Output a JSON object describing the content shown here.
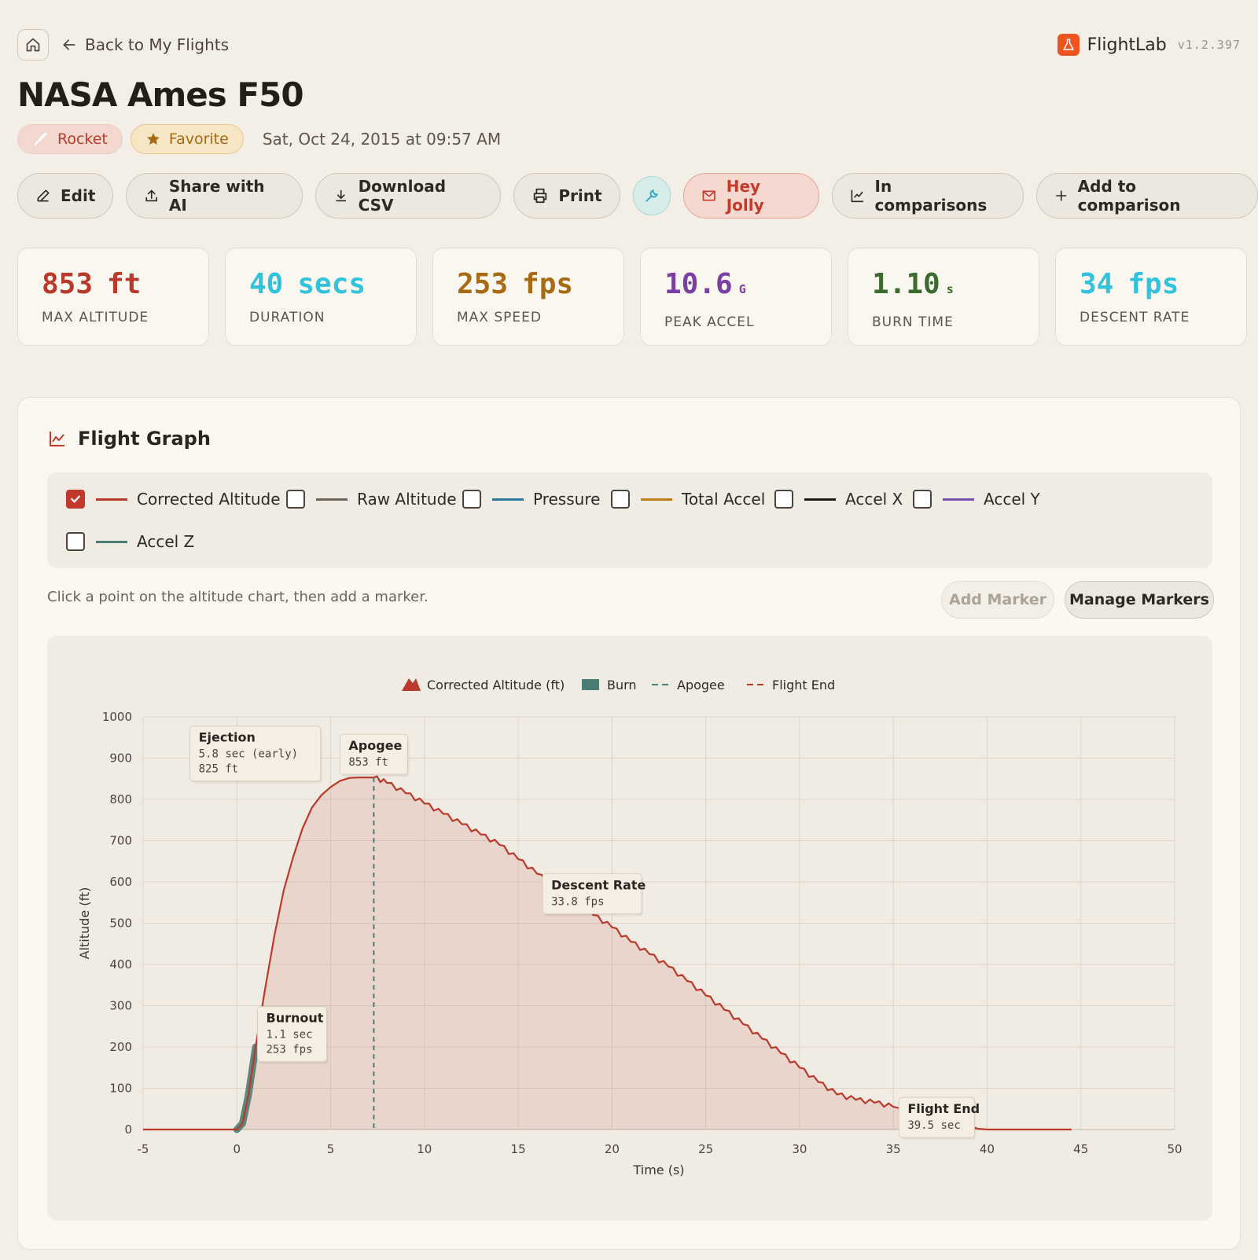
{
  "nav": {
    "back_label": "Back to My Flights"
  },
  "brand": {
    "name": "FlightLab",
    "version": "v1.2.397"
  },
  "flight": {
    "title": "NASA Ames F50",
    "type_badge": "Rocket",
    "favorite_badge": "Favorite",
    "date": "Sat, Oct 24, 2015 at 09:57 AM"
  },
  "actions": {
    "edit": "Edit",
    "share": "Share with AI",
    "download": "Download CSV",
    "print": "Print",
    "jolly": "Hey Jolly",
    "in_comparisons": "In comparisons",
    "add_comparison": "Add to comparison"
  },
  "stats": [
    {
      "value": "853",
      "unit": "ft",
      "label": "MAX ALTITUDE",
      "color": "#b93a2a",
      "unit_style": "big"
    },
    {
      "value": "40",
      "unit": "secs",
      "label": "DURATION",
      "color": "#31c2dc",
      "unit_style": "big"
    },
    {
      "value": "253",
      "unit": "fps",
      "label": "MAX SPEED",
      "color": "#a86a12",
      "unit_style": "big"
    },
    {
      "value": "10.6",
      "unit": "G",
      "label": "PEAK ACCEL",
      "color": "#7a3fa0",
      "unit_style": "small"
    },
    {
      "value": "1.10",
      "unit": "s",
      "label": "BURN TIME",
      "color": "#3c6b2e",
      "unit_style": "small"
    },
    {
      "value": "34",
      "unit": "fps",
      "label": "DESCENT RATE",
      "color": "#31c2dc",
      "unit_style": "big"
    }
  ],
  "graph": {
    "title": "Flight Graph",
    "hint": "Click a point on the altitude chart, then add a marker.",
    "add_marker": "Add Marker",
    "manage_markers": "Manage Markers",
    "series_toggles": [
      {
        "label": "Corrected Altitude",
        "checked": true,
        "color": "#b93a2a"
      },
      {
        "label": "Raw Altitude",
        "checked": false,
        "color": "#6b655b"
      },
      {
        "label": "Pressure",
        "checked": false,
        "color": "#2b7a9e"
      },
      {
        "label": "Total Accel",
        "checked": false,
        "color": "#c07a16"
      },
      {
        "label": "Accel X",
        "checked": false,
        "color": "#1c1a17"
      },
      {
        "label": "Accel Y",
        "checked": false,
        "color": "#7a4fb0"
      },
      {
        "label": "Accel Z",
        "checked": false,
        "color": "#4a7d74"
      }
    ]
  },
  "chart_data": {
    "type": "area",
    "xlabel": "Time (s)",
    "ylabel": "Altitude (ft)",
    "xlim": [
      -5,
      50
    ],
    "ylim": [
      0,
      1000
    ],
    "xticks": [
      -5,
      0,
      5,
      10,
      15,
      20,
      25,
      30,
      35,
      40,
      45,
      50
    ],
    "yticks": [
      0,
      100,
      200,
      300,
      400,
      500,
      600,
      700,
      800,
      900,
      1000
    ],
    "grid": true,
    "legend_position": "top-center",
    "legend": [
      {
        "label": "Corrected Altitude (ft)",
        "kind": "area",
        "color": "#b93a2a"
      },
      {
        "label": "Burn",
        "kind": "block",
        "color": "#4a7d74"
      },
      {
        "label": "Apogee",
        "kind": "dashed",
        "color": "#4a7d74"
      },
      {
        "label": "Flight End",
        "kind": "dashed",
        "color": "#b93a2a"
      }
    ],
    "series": [
      {
        "name": "Corrected Altitude (ft)",
        "x": [
          -5,
          -3,
          -1,
          0,
          0.3,
          0.6,
          1.0,
          1.5,
          2,
          2.5,
          3,
          3.5,
          4,
          4.5,
          5,
          5.5,
          6,
          6.5,
          7,
          7.3,
          8,
          9,
          10,
          11,
          12,
          13,
          14,
          15,
          16,
          17,
          18,
          19,
          20,
          21,
          22,
          23,
          24,
          25,
          26,
          27,
          28,
          29,
          30,
          31,
          32,
          33,
          34,
          35,
          36,
          37,
          38,
          39,
          39.5,
          40,
          42,
          44.5
        ],
        "y": [
          0,
          0,
          0,
          0,
          15,
          80,
          200,
          340,
          470,
          580,
          660,
          730,
          780,
          810,
          830,
          845,
          852,
          853,
          853,
          853,
          840,
          815,
          790,
          765,
          740,
          715,
          690,
          655,
          620,
          585,
          552,
          520,
          490,
          455,
          425,
          395,
          360,
          325,
          290,
          255,
          220,
          185,
          150,
          115,
          85,
          72,
          65,
          55,
          45,
          38,
          22,
          10,
          2,
          0,
          0,
          0
        ]
      }
    ],
    "burn": {
      "x_start": 0,
      "x_end": 1.1
    },
    "apogee_x": 7.3,
    "annotations": [
      {
        "title": "Ejection",
        "lines": [
          "5.8 sec (early)",
          "825 ft"
        ],
        "x": -2.5,
        "y": 955
      },
      {
        "title": "Apogee",
        "lines": [
          "853 ft"
        ],
        "x": 7.3,
        "y": 935
      },
      {
        "title": "Descent Rate",
        "lines": [
          "33.8 fps"
        ],
        "x": 16.3,
        "y": 597
      },
      {
        "title": "Burnout",
        "lines": [
          "1.1 sec",
          "253 fps"
        ],
        "x": 1.1,
        "y": 275
      },
      {
        "title": "Flight End",
        "lines": [
          "39.5 sec"
        ],
        "x": 35.3,
        "y": 55
      }
    ]
  }
}
